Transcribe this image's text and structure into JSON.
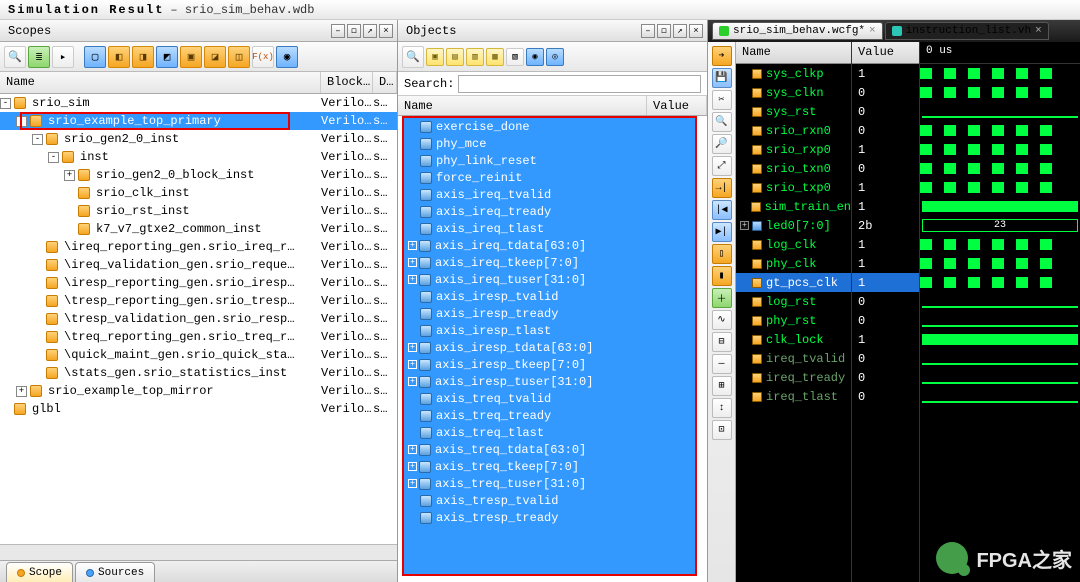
{
  "window": {
    "title": "Simulation Result",
    "file": "srio_sim_behav.wdb"
  },
  "scopes": {
    "title": "Scopes",
    "columns": {
      "name": "Name",
      "block": "Block…",
      "d": "D…"
    },
    "rows": [
      {
        "indent": 0,
        "exp": "-",
        "label": "srio_sim",
        "blk": "Verilo…",
        "d": "s…"
      },
      {
        "indent": 1,
        "exp": "-",
        "label": "srio_example_top_primary",
        "blk": "Verilo…",
        "d": "s…",
        "selected": true
      },
      {
        "indent": 2,
        "exp": "-",
        "label": "srio_gen2_0_inst",
        "blk": "Verilo…",
        "d": "s…"
      },
      {
        "indent": 3,
        "exp": "-",
        "label": "inst",
        "blk": "Verilo…",
        "d": "s…"
      },
      {
        "indent": 4,
        "exp": "+",
        "label": "srio_gen2_0_block_inst",
        "blk": "Verilo…",
        "d": "s…"
      },
      {
        "indent": 4,
        "exp": "",
        "label": "srio_clk_inst",
        "blk": "Verilo…",
        "d": "s…"
      },
      {
        "indent": 4,
        "exp": "",
        "label": "srio_rst_inst",
        "blk": "Verilo…",
        "d": "s…"
      },
      {
        "indent": 4,
        "exp": "",
        "label": "k7_v7_gtxe2_common_inst",
        "blk": "Verilo…",
        "d": "s…"
      },
      {
        "indent": 2,
        "exp": "",
        "label": "\\ireq_reporting_gen.srio_ireq_r…",
        "blk": "Verilo…",
        "d": "s…"
      },
      {
        "indent": 2,
        "exp": "",
        "label": "\\ireq_validation_gen.srio_reque…",
        "blk": "Verilo…",
        "d": "s…"
      },
      {
        "indent": 2,
        "exp": "",
        "label": "\\iresp_reporting_gen.srio_iresp…",
        "blk": "Verilo…",
        "d": "s…"
      },
      {
        "indent": 2,
        "exp": "",
        "label": "\\tresp_reporting_gen.srio_tresp…",
        "blk": "Verilo…",
        "d": "s…"
      },
      {
        "indent": 2,
        "exp": "",
        "label": "\\tresp_validation_gen.srio_resp…",
        "blk": "Verilo…",
        "d": "s…"
      },
      {
        "indent": 2,
        "exp": "",
        "label": "\\treq_reporting_gen.srio_treq_r…",
        "blk": "Verilo…",
        "d": "s…"
      },
      {
        "indent": 2,
        "exp": "",
        "label": "\\quick_maint_gen.srio_quick_sta…",
        "blk": "Verilo…",
        "d": "s…"
      },
      {
        "indent": 2,
        "exp": "",
        "label": "\\stats_gen.srio_statistics_inst",
        "blk": "Verilo…",
        "d": "s…"
      },
      {
        "indent": 1,
        "exp": "+",
        "label": "srio_example_top_mirror",
        "blk": "Verilo…",
        "d": "s…"
      },
      {
        "indent": 0,
        "exp": "",
        "label": "glbl",
        "blk": "Verilo…",
        "d": "s…"
      }
    ],
    "tabs": {
      "scope": "Scope",
      "sources": "Sources"
    }
  },
  "objects": {
    "title": "Objects",
    "search_label": "Search:",
    "search_value": "",
    "columns": {
      "name": "Name",
      "value": "Value"
    },
    "items": [
      {
        "exp": "",
        "name": "exercise_done"
      },
      {
        "exp": "",
        "name": "phy_mce"
      },
      {
        "exp": "",
        "name": "phy_link_reset"
      },
      {
        "exp": "",
        "name": "force_reinit"
      },
      {
        "exp": "",
        "name": "axis_ireq_tvalid"
      },
      {
        "exp": "",
        "name": "axis_ireq_tready"
      },
      {
        "exp": "",
        "name": "axis_ireq_tlast"
      },
      {
        "exp": "+",
        "name": "axis_ireq_tdata[63:0]"
      },
      {
        "exp": "+",
        "name": "axis_ireq_tkeep[7:0]"
      },
      {
        "exp": "+",
        "name": "axis_ireq_tuser[31:0]"
      },
      {
        "exp": "",
        "name": "axis_iresp_tvalid"
      },
      {
        "exp": "",
        "name": "axis_iresp_tready"
      },
      {
        "exp": "",
        "name": "axis_iresp_tlast"
      },
      {
        "exp": "+",
        "name": "axis_iresp_tdata[63:0]"
      },
      {
        "exp": "+",
        "name": "axis_iresp_tkeep[7:0]"
      },
      {
        "exp": "+",
        "name": "axis_iresp_tuser[31:0]"
      },
      {
        "exp": "",
        "name": "axis_treq_tvalid"
      },
      {
        "exp": "",
        "name": "axis_treq_tready"
      },
      {
        "exp": "",
        "name": "axis_treq_tlast"
      },
      {
        "exp": "+",
        "name": "axis_treq_tdata[63:0]"
      },
      {
        "exp": "+",
        "name": "axis_treq_tkeep[7:0]"
      },
      {
        "exp": "+",
        "name": "axis_treq_tuser[31:0]"
      },
      {
        "exp": "",
        "name": "axis_tresp_tvalid"
      },
      {
        "exp": "",
        "name": "axis_tresp_tready"
      }
    ]
  },
  "wave": {
    "tabs": [
      {
        "label": "srio_sim_behav.wcfg*",
        "active": true,
        "icon": "green"
      },
      {
        "label": "instruction_list.vh",
        "active": false,
        "icon": "teal"
      }
    ],
    "name_header": "Name",
    "value_header": "Value",
    "time_label": "0 us",
    "signals": [
      {
        "name": "sys_clkp",
        "value": "1",
        "type": "clk"
      },
      {
        "name": "sys_clkn",
        "value": "0",
        "type": "clk"
      },
      {
        "name": "sys_rst",
        "value": "0",
        "type": "sig"
      },
      {
        "name": "srio_rxn0",
        "value": "0",
        "type": "clk"
      },
      {
        "name": "srio_rxp0",
        "value": "1",
        "type": "clk"
      },
      {
        "name": "srio_txn0",
        "value": "0",
        "type": "clk"
      },
      {
        "name": "srio_txp0",
        "value": "1",
        "type": "clk"
      },
      {
        "name": "sim_train_en",
        "value": "1",
        "type": "sig"
      },
      {
        "name": "led0[7:0]",
        "value": "2b",
        "type": "bus",
        "exp": "+",
        "bus_label": "23"
      },
      {
        "name": "log_clk",
        "value": "1",
        "type": "clk"
      },
      {
        "name": "phy_clk",
        "value": "1",
        "type": "clk"
      },
      {
        "name": "gt_pcs_clk",
        "value": "1",
        "type": "clk",
        "selected": true
      },
      {
        "name": "log_rst",
        "value": "0",
        "type": "sig"
      },
      {
        "name": "phy_rst",
        "value": "0",
        "type": "sig"
      },
      {
        "name": "clk_lock",
        "value": "1",
        "type": "sig"
      },
      {
        "name": "ireq_tvalid",
        "value": "0",
        "type": "sig",
        "dim": true
      },
      {
        "name": "ireq_tready",
        "value": "0",
        "type": "sig",
        "dim": true
      },
      {
        "name": "ireq_tlast",
        "value": "0",
        "type": "sig",
        "dim": true
      }
    ]
  },
  "watermark": "FPGA之家"
}
